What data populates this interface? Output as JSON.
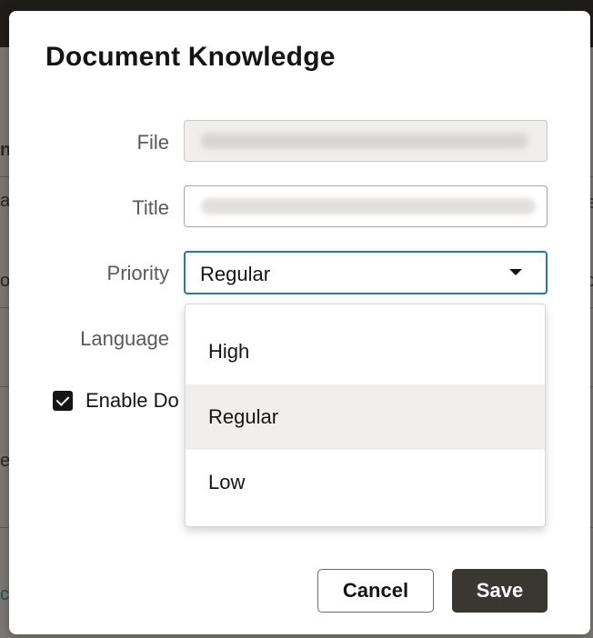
{
  "background": {
    "fragments": [
      "n",
      "a",
      "e",
      "o",
      "c",
      "e",
      "c"
    ]
  },
  "dialog": {
    "title": "Document Knowledge",
    "fields": {
      "file_label": "File",
      "title_label": "Title",
      "priority_label": "Priority",
      "priority_value": "Regular",
      "language_label": "Language"
    },
    "checkbox": {
      "label": "Enable Do",
      "checked": true
    },
    "priority_options": [
      "High",
      "Regular",
      "Low"
    ],
    "selected_option": "Regular",
    "buttons": {
      "cancel": "Cancel",
      "save": "Save"
    }
  },
  "colors": {
    "focus_border": "#227e9e",
    "primary_button": "#3a3632",
    "selected_option_bg": "#f1efed"
  }
}
